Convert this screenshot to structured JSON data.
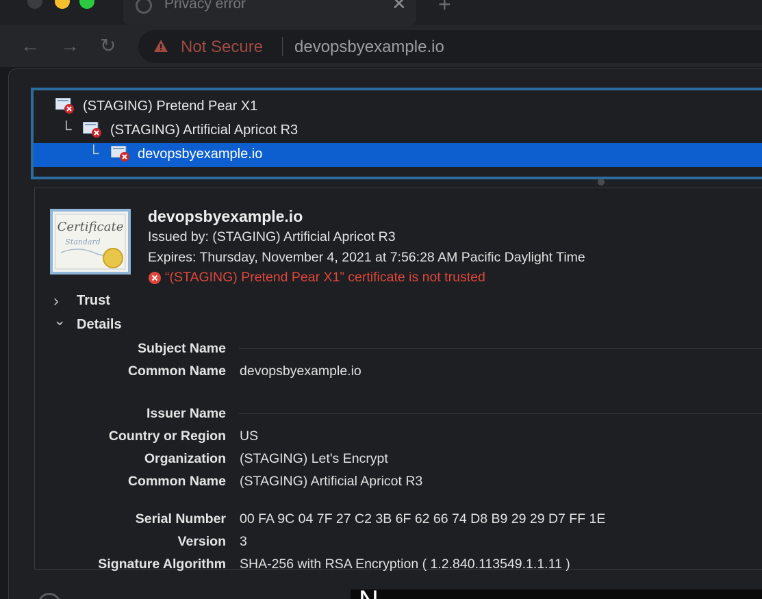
{
  "browser": {
    "tab": {
      "title": "Privacy error",
      "close_glyph": "✕"
    },
    "new_tab_glyph": "+",
    "nav": {
      "back": "←",
      "forward": "→",
      "reload": "↻"
    },
    "address": {
      "security_label": "Not Secure",
      "url": "devopsbyexample.io",
      "warning_color": "#a04a42"
    }
  },
  "chain": {
    "items": [
      {
        "label": "(STAGING) Pretend Pear X1",
        "level": 0,
        "selected": false
      },
      {
        "label": "(STAGING) Artificial Apricot R3",
        "level": 1,
        "selected": false
      },
      {
        "label": "devopsbyexample.io",
        "level": 2,
        "selected": true
      }
    ],
    "branch_glyph": "└"
  },
  "certificate": {
    "icon_text": {
      "title": "Certificate",
      "subtitle": "Standard"
    },
    "title": "devopsbyexample.io",
    "issued_by": "Issued by: (STAGING) Artificial Apricot R3",
    "expires": "Expires: Thursday, November 4, 2021 at 7:56:28 AM Pacific Daylight Time",
    "error": "“(STAGING) Pretend Pear X1” certificate is not trusted",
    "error_color": "#e0463c"
  },
  "sections": {
    "trust": {
      "label": "Trust",
      "glyph": "›"
    },
    "details": {
      "label": "Details",
      "glyph": "⌄"
    }
  },
  "details": {
    "subject_name": "Subject Name",
    "subject_common_name_key": "Common Name",
    "subject_common_name_val": "devopsbyexample.io",
    "issuer_name": "Issuer Name",
    "country_key": "Country or Region",
    "country_val": "US",
    "organization_key": "Organization",
    "organization_val": "(STAGING) Let's Encrypt",
    "issuer_common_name_key": "Common Name",
    "issuer_common_name_val": "(STAGING) Artificial Apricot R3",
    "serial_key": "Serial Number",
    "serial_val": "00 FA 9C 04 7F 27 C2 3B 6F 62 66 74 D8 B9 29 29 D7 FF 1E",
    "version_key": "Version",
    "version_val": "3",
    "sigalg_key": "Signature Algorithm",
    "sigalg_val": "SHA-256 with RSA Encryption ( 1.2.840.113549.1.1.11 )"
  },
  "subtitle": {
    "text": "N"
  }
}
